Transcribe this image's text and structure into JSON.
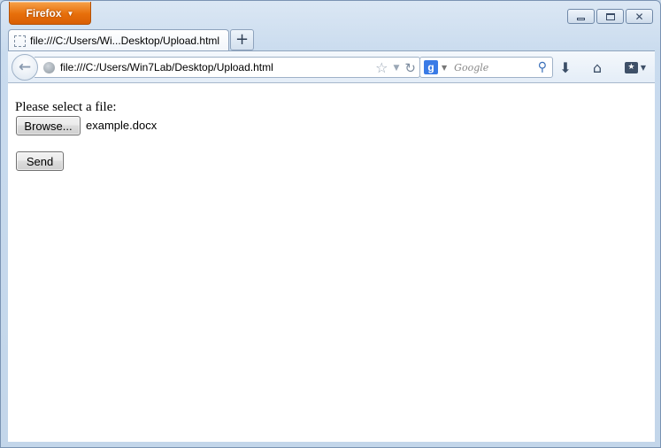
{
  "app": {
    "menu_button": "Firefox"
  },
  "tab": {
    "title": "file:///C:/Users/Wi...Desktop/Upload.html"
  },
  "new_tab_label": "+",
  "navbar": {
    "url": "file:///C:/Users/Win7Lab/Desktop/Upload.html",
    "search_engine_letter": "g",
    "search_placeholder": "Google"
  },
  "page": {
    "prompt": "Please select a file:",
    "browse_label": "Browse...",
    "selected_file": "example.docx",
    "send_label": "Send"
  },
  "colors": {
    "firefox_orange": "#e76f0b",
    "chrome_blue": "#c9dbee",
    "content_bg": "#ffffff"
  }
}
